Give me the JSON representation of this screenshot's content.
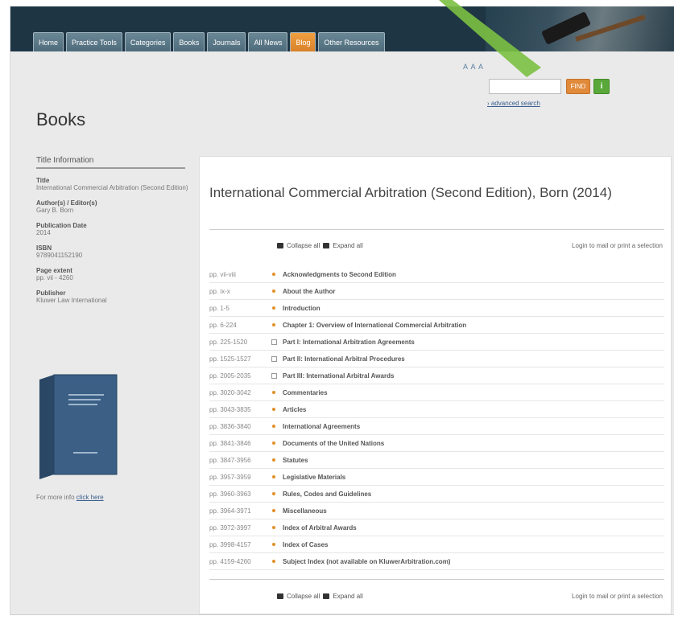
{
  "nav": {
    "tabs": [
      "Home",
      "Practice Tools",
      "Categories",
      "Books",
      "Journals",
      "All News",
      "Blog",
      "Other Resources"
    ],
    "active_index": 6
  },
  "header": {
    "font_size_control": "A A A",
    "search_placeholder": "",
    "find_label": "FIND",
    "info_label": "i",
    "advanced_search": "advanced search"
  },
  "page_title": "Books",
  "sidebar": {
    "heading": "Title Information",
    "fields": [
      {
        "label": "Title",
        "value": "International Commercial Arbitration (Second Edition)"
      },
      {
        "label": "Author(s) / Editor(s)",
        "value": "Gary B. Born"
      },
      {
        "label": "Publication Date",
        "value": "2014"
      },
      {
        "label": "ISBN",
        "value": "9789041152190"
      },
      {
        "label": "Page extent",
        "value": "pp. vii - 4260"
      },
      {
        "label": "Publisher",
        "value": "Kluwer Law International"
      }
    ],
    "more_info_text": "For more info ",
    "more_info_link": "click here"
  },
  "main": {
    "title": "International Commercial Arbitration (Second Edition), Born (2014)",
    "collapse_all": "Collapse all",
    "expand_all": "Expand all",
    "login_text": "Login to mail or print a selection",
    "toc": [
      {
        "pages": "pp. vii-viii",
        "type": "dot",
        "title": "Acknowledgments to Second Edition"
      },
      {
        "pages": "pp. ix-x",
        "type": "dot",
        "title": "About the Author"
      },
      {
        "pages": "pp. 1-5",
        "type": "dot",
        "title": "Introduction"
      },
      {
        "pages": "pp. 6-224",
        "type": "dot",
        "title": "Chapter 1: Overview of International Commercial Arbitration"
      },
      {
        "pages": "pp. 225-1520",
        "type": "box",
        "title": "Part I: International Arbitration Agreements"
      },
      {
        "pages": "pp. 1525-1527",
        "type": "box",
        "title": "Part II: International Arbitral Procedures"
      },
      {
        "pages": "pp. 2005-2035",
        "type": "box",
        "title": "Part III: International Arbitral Awards"
      },
      {
        "pages": "pp. 3020-3042",
        "type": "dot",
        "title": "Commentaries"
      },
      {
        "pages": "pp. 3043-3835",
        "type": "dot",
        "title": "Articles"
      },
      {
        "pages": "pp. 3836-3840",
        "type": "dot",
        "title": "International Agreements"
      },
      {
        "pages": "pp. 3841-3846",
        "type": "dot",
        "title": "Documents of the United Nations"
      },
      {
        "pages": "pp. 3847-3956",
        "type": "dot",
        "title": "Statutes"
      },
      {
        "pages": "pp. 3957-3959",
        "type": "dot",
        "title": "Legislative Materials"
      },
      {
        "pages": "pp. 3960-3963",
        "type": "dot",
        "title": "Rules, Codes and Guidelines"
      },
      {
        "pages": "pp. 3964-3971",
        "type": "dot",
        "title": "Miscellaneous"
      },
      {
        "pages": "pp. 3972-3997",
        "type": "dot",
        "title": "Index of Arbitral Awards"
      },
      {
        "pages": "pp. 3998-4157",
        "type": "dot",
        "title": "Index of Cases"
      },
      {
        "pages": "pp. 4159-4260",
        "type": "dot",
        "title": "Subject Index (not available on KluwerArbitration.com)"
      }
    ]
  },
  "colors": {
    "header": "#1e3544",
    "tab": "#5a7888",
    "active_tab": "#e08a3a",
    "bullet": "#e0902a",
    "arrow": "#7bc043"
  }
}
